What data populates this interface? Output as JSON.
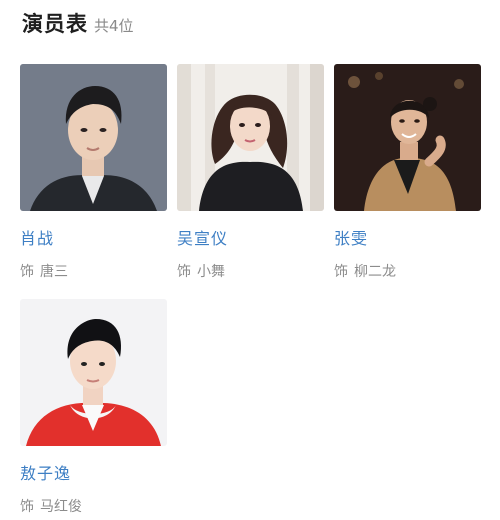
{
  "header": {
    "title": "演员表",
    "count": "共4位"
  },
  "cast": [
    {
      "name": "肖战",
      "role_prefix": "饰",
      "role": "唐三"
    },
    {
      "name": "吴宣仪",
      "role_prefix": "饰",
      "role": "小舞"
    },
    {
      "name": "张雯",
      "role_prefix": "饰",
      "role": "柳二龙"
    },
    {
      "name": "敖子逸",
      "role_prefix": "饰",
      "role": "马红俊"
    }
  ],
  "colors": {
    "name_link": "#3e7fc4",
    "muted": "#8c8c8c",
    "title": "#1f1f1f"
  }
}
